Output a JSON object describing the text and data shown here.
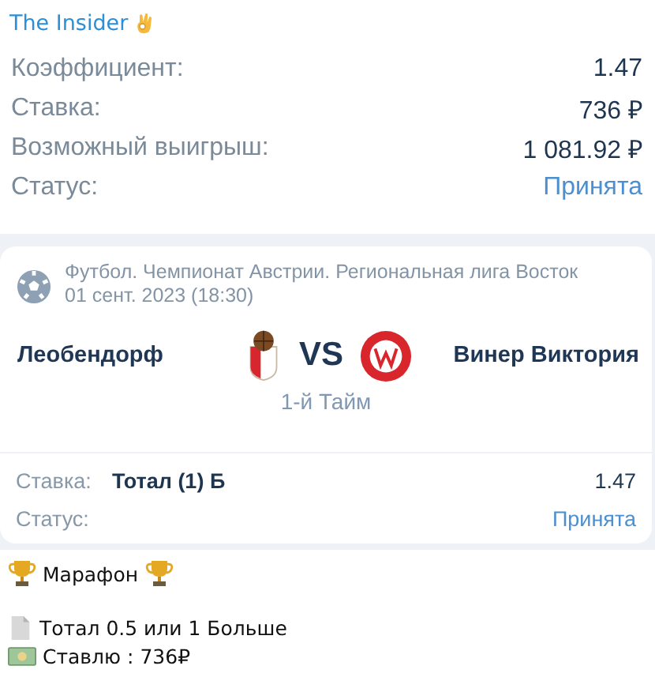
{
  "channel": {
    "name": "The Insider"
  },
  "summary": [
    {
      "label": "Коэффициент:",
      "value": "1.47",
      "kind": "plain"
    },
    {
      "label": "Ставка:",
      "value": "736 ₽",
      "kind": "plain"
    },
    {
      "label": "Возможный выигрыш:",
      "value": "1 081.92 ₽",
      "kind": "plain"
    },
    {
      "label": "Статус:",
      "value": "Принята",
      "kind": "status"
    }
  ],
  "match": {
    "league": "Футбол. Чемпионат Австрии. Региональная лига Восток",
    "date": "01 сент. 2023 (18:30)",
    "home": "Леобендорф",
    "vs": "VS",
    "away": "Винер Виктория",
    "period": "1-й Тайм",
    "bet": [
      {
        "label": "Ставка:",
        "detail": "Тотал (1) Б",
        "value": "1.47",
        "kind": "plain"
      },
      {
        "label": "Статус:",
        "value": "Принята",
        "kind": "status"
      }
    ]
  },
  "message": {
    "title": "Марафон",
    "lines": [
      {
        "text": "Тотал 0.5 или 1 Больше",
        "kind": "document"
      },
      {
        "text": "Ставлю : 736₽",
        "kind": "money"
      }
    ]
  }
}
